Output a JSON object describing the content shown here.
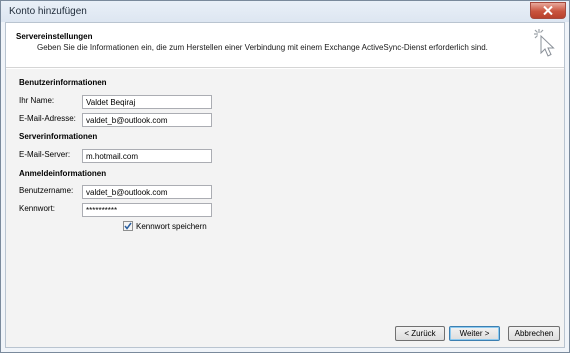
{
  "window": {
    "title": "Konto hinzufügen"
  },
  "header": {
    "title": "Servereinstellungen",
    "description": "Geben Sie die Informationen ein, die zum Herstellen einer Verbindung mit einem Exchange ActiveSync-Dienst erforderlich sind.",
    "icon": "pointer-sparkle-icon"
  },
  "sections": {
    "user_info": "Benutzerinformationen",
    "server_info": "Serverinformationen",
    "login_info": "Anmeldeinformationen"
  },
  "fields": {
    "name_label": "Ihr Name:",
    "name_value": "Valdet Beqiraj",
    "email_label": "E-Mail-Adresse:",
    "email_value": "valdet_b@outlook.com",
    "server_label": "E-Mail-Server:",
    "server_value": "m.hotmail.com",
    "username_label": "Benutzername:",
    "username_value": "valdet_b@outlook.com",
    "password_label": "Kennwort:",
    "password_value": "**********"
  },
  "checkbox": {
    "label": "Kennwort speichern",
    "checked": true
  },
  "buttons": {
    "back": "< Zurück",
    "next": "Weiter >",
    "cancel": "Abbrechen"
  },
  "colors": {
    "close_button": "#c9543e",
    "default_button_border": "#3c7fb1"
  }
}
